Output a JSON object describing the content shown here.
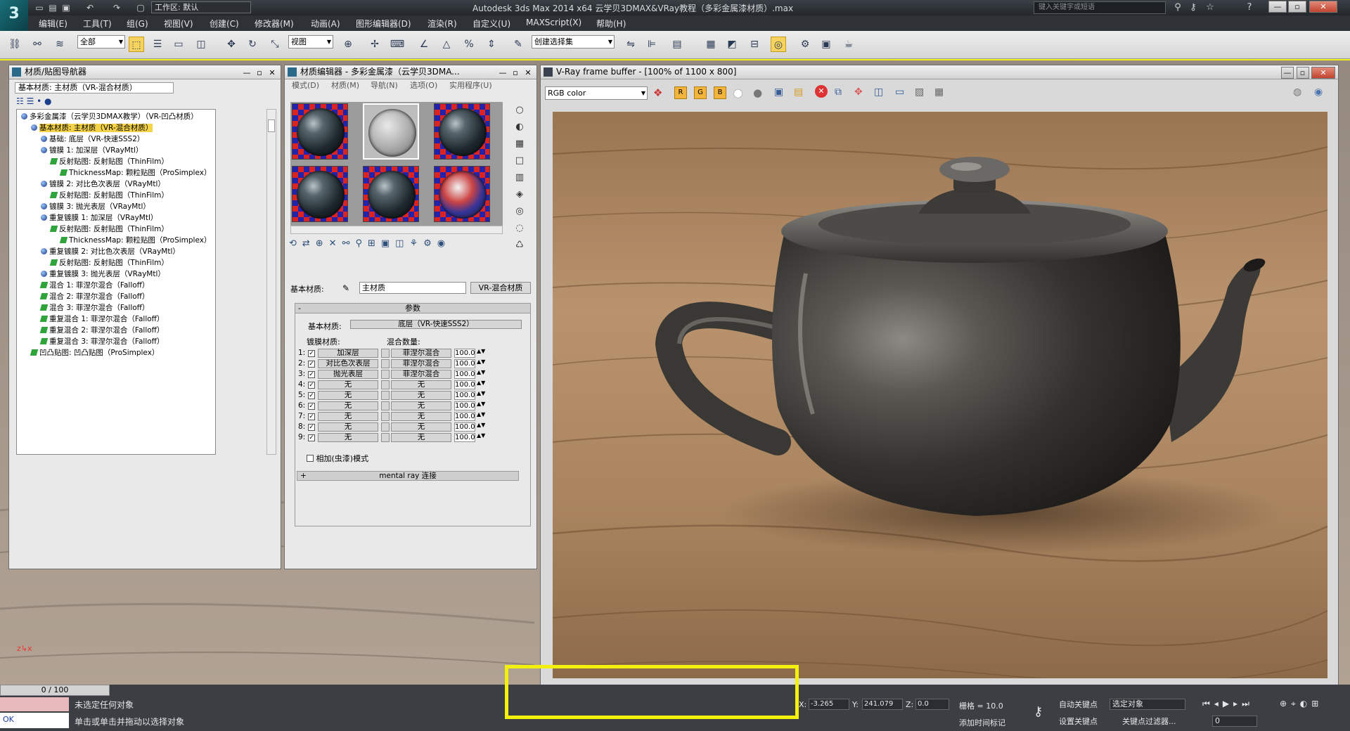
{
  "app": {
    "logo": "3",
    "title": "Autodesk 3ds Max  2014 x64     云学贝3DMAX&VRay教程（多彩金属漆材质）.max",
    "workspace": "工作区: 默认",
    "search_placeholder": "键入关键字或短语",
    "win_min": "—",
    "win_max": "▫",
    "win_close": "✕"
  },
  "menu": [
    "编辑(E)",
    "工具(T)",
    "组(G)",
    "视图(V)",
    "创建(C)",
    "修改器(M)",
    "动画(A)",
    "图形编辑器(D)",
    "渲染(R)",
    "自定义(U)",
    "MAXScript(X)",
    "帮助(H)"
  ],
  "toolbar": {
    "filter": "全部",
    "ref_coord": "视图",
    "selection_set": "创建选择集"
  },
  "navigator": {
    "title": "材质/贴图导航器",
    "subtitle": "基本材质: 主材质（VR-混合材质）",
    "tree": [
      {
        "indent": 0,
        "kind": "ball",
        "text": "多彩金属漆（云学贝3DMAX教学）（VR-凹凸材质）"
      },
      {
        "indent": 1,
        "kind": "ball",
        "text": "基本材质: 主材质（VR-混合材质）",
        "hl": true
      },
      {
        "indent": 2,
        "kind": "ball",
        "text": "基础: 底层（VR-快速SSS2）"
      },
      {
        "indent": 2,
        "kind": "ball",
        "text": "镀膜 1: 加深层（VRayMtl）"
      },
      {
        "indent": 3,
        "kind": "map",
        "text": "反射贴图: 反射贴图（ThinFilm）"
      },
      {
        "indent": 4,
        "kind": "map",
        "text": "ThicknessMap: 颗粒贴图（ProSimplex）"
      },
      {
        "indent": 2,
        "kind": "ball",
        "text": "镀膜 2: 对比色次表层（VRayMtl）"
      },
      {
        "indent": 3,
        "kind": "map",
        "text": "反射贴图: 反射贴图（ThinFilm）"
      },
      {
        "indent": 2,
        "kind": "ball",
        "text": "镀膜 3: 抛光表层（VRayMtl）"
      },
      {
        "indent": 2,
        "kind": "ball",
        "text": "重复镀膜 1: 加深层（VRayMtl）"
      },
      {
        "indent": 3,
        "kind": "map",
        "text": "反射贴图: 反射贴图（ThinFilm）"
      },
      {
        "indent": 4,
        "kind": "map",
        "text": "ThicknessMap: 颗粒贴图（ProSimplex）"
      },
      {
        "indent": 2,
        "kind": "ball",
        "text": "重复镀膜 2: 对比色次表层（VRayMtl）"
      },
      {
        "indent": 3,
        "kind": "map",
        "text": "反射贴图: 反射贴图（ThinFilm）"
      },
      {
        "indent": 2,
        "kind": "ball",
        "text": "重复镀膜 3: 抛光表层（VRayMtl）"
      },
      {
        "indent": 2,
        "kind": "map",
        "text": "混合 1: 菲涅尔混合（Falloff）"
      },
      {
        "indent": 2,
        "kind": "map",
        "text": "混合 2: 菲涅尔混合（Falloff）"
      },
      {
        "indent": 2,
        "kind": "map",
        "text": "混合 3: 菲涅尔混合（Falloff）"
      },
      {
        "indent": 2,
        "kind": "map",
        "text": "重复混合 1: 菲涅尔混合（Falloff）"
      },
      {
        "indent": 2,
        "kind": "map",
        "text": "重复混合 2: 菲涅尔混合（Falloff）"
      },
      {
        "indent": 2,
        "kind": "map",
        "text": "重复混合 3: 菲涅尔混合（Falloff）"
      },
      {
        "indent": 1,
        "kind": "map",
        "text": "凹凸贴图: 凹凸贴图（ProSimplex）"
      }
    ]
  },
  "mat_editor": {
    "title": "材质编辑器 - 多彩金属漆（云学贝3DMA...",
    "menu": [
      "模式(D)",
      "材质(M)",
      "导航(N)",
      "选项(O)",
      "实用程序(U)"
    ],
    "base_label": "基本材质:",
    "mat_name": "主材质",
    "mat_type": "VR-混合材质",
    "rollout_params": "参数",
    "base_mat_label": "基本材质:",
    "base_mat": "底层（VR-快速SSS2）",
    "coat_label": "镀膜材质:",
    "blend_label": "混合数量:",
    "coats": [
      {
        "idx": "1:",
        "mat": "加深层",
        "blend": "菲涅尔混合",
        "amt": "100.0"
      },
      {
        "idx": "2:",
        "mat": "对比色次表层",
        "blend": "菲涅尔混合",
        "amt": "100.0"
      },
      {
        "idx": "3:",
        "mat": "抛光表层",
        "blend": "菲涅尔混合",
        "amt": "100.0"
      },
      {
        "idx": "4:",
        "mat": "无",
        "blend": "无",
        "amt": "100.0"
      },
      {
        "idx": "5:",
        "mat": "无",
        "blend": "无",
        "amt": "100.0"
      },
      {
        "idx": "6:",
        "mat": "无",
        "blend": "无",
        "amt": "100.0"
      },
      {
        "idx": "7:",
        "mat": "无",
        "blend": "无",
        "amt": "100.0"
      },
      {
        "idx": "8:",
        "mat": "无",
        "blend": "无",
        "amt": "100.0"
      },
      {
        "idx": "9:",
        "mat": "无",
        "blend": "无",
        "amt": "100.0"
      }
    ],
    "additive": "相加(虫漆)模式",
    "mental_ray": "mental ray 连接"
  },
  "vfb": {
    "title": "V-Ray frame buffer - [100% of 1100 x 800]",
    "channel": "RGB color"
  },
  "status": {
    "timeline": "0 / 100",
    "listener": "OK",
    "msg1": "未选定任何对象",
    "msg2": "单击或单击并拖动以选择对象",
    "x_label": "X:",
    "x_val": "-3.265",
    "y_label": "Y:",
    "y_val": "241.079",
    "z_label": "Z:",
    "z_val": "0.0",
    "grid": "栅格 = 10.0",
    "add_time_tag": "添加时间标记",
    "auto_key": "自动关键点",
    "selected": "选定对象",
    "set_key": "设置关键点",
    "key_filters": "关键点过滤器...",
    "frame": "0"
  },
  "colors": {
    "highlight": "#f4f00d",
    "tree_selected": "#f4d24a",
    "titlebar": "#2b2f34"
  }
}
